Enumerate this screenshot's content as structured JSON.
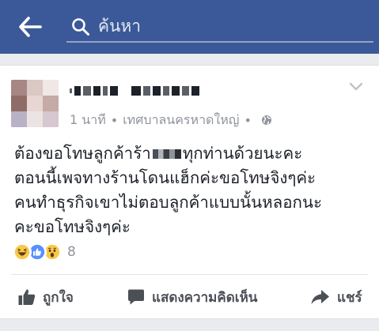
{
  "colors": {
    "header_bg": "#3b5998",
    "page_bg": "#e9ebee",
    "text_primary": "#1d2129",
    "text_secondary": "#90949c",
    "action_text": "#4b4f56",
    "like_blue": "#5890ff",
    "haha_yellow": "#f7c948"
  },
  "header": {
    "back_icon": "arrow-left-icon",
    "search_icon": "search-icon",
    "search_placeholder": "ค้นหา"
  },
  "post": {
    "avatar_icon": "profile-photo-pixelated",
    "time": "1 นาที",
    "separator": "•",
    "location": "เทศบาลนครหาดใหญ่",
    "separator2": "•",
    "privacy_icon": "globe-icon",
    "text_lines": [
      {
        "before": "ต้องขอโทษลูกค้าร้า",
        "after": "ทุกท่านด้วยนะคะ"
      },
      {
        "text": "ตอนนี้เพจทางร้านโดนแฮ็กค่ะขอโทษจิงๆค่ะ"
      },
      {
        "text": "คนทำธุรกิจเขาไม่ตอบลูกค้าแบบนั้นหลอกนะ"
      },
      {
        "text": "คะขอโทษจิงๆค่ะ"
      }
    ],
    "reactions": [
      "haha-icon",
      "like-icon",
      "wow-icon"
    ],
    "reaction_count": "8"
  },
  "actions": {
    "like_label": "ถูกใจ",
    "comment_label": "แสดงความคิดเห็น",
    "share_label": "แชร์"
  }
}
